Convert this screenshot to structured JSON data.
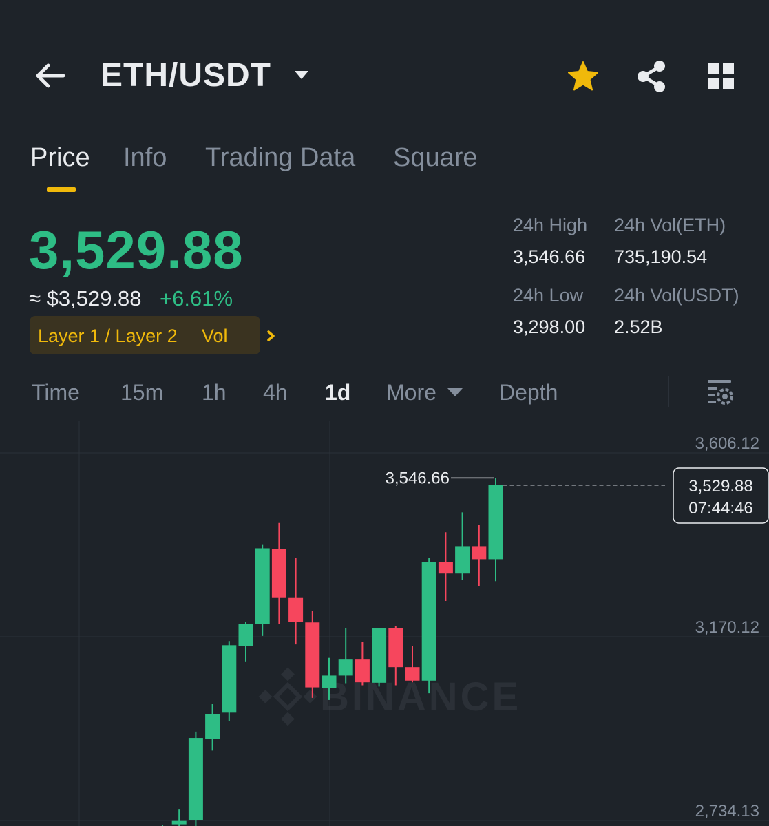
{
  "header": {
    "pair": "ETH/USDT",
    "icons": [
      "arrow-left-icon",
      "caret-down-icon",
      "star-icon",
      "share-icon",
      "grid-icon"
    ],
    "star_color": "#f0b90b"
  },
  "tabs": [
    {
      "label": "Price",
      "active": true
    },
    {
      "label": "Info",
      "active": false
    },
    {
      "label": "Trading Data",
      "active": false
    },
    {
      "label": "Square",
      "active": false
    }
  ],
  "price": {
    "last": "3,529.88",
    "approx_usd": "≈ $3,529.88",
    "change_pct": "+6.61%",
    "tag_category": "Layer 1 / Layer 2",
    "tag_vol": "Vol",
    "up_color": "#2ebd85",
    "down_color": "#f6465d",
    "accent_color": "#f0b90b"
  },
  "stats": {
    "high_label": "24h High",
    "high_value": "3,546.66",
    "vol_eth_label": "24h Vol(ETH)",
    "vol_eth_value": "735,190.54",
    "low_label": "24h Low",
    "low_value": "3,298.00",
    "vol_usdt_label": "24h Vol(USDT)",
    "vol_usdt_value": "2.52B"
  },
  "intervals": [
    {
      "label": "Time",
      "active": false
    },
    {
      "label": "15m",
      "active": false
    },
    {
      "label": "1h",
      "active": false
    },
    {
      "label": "4h",
      "active": false
    },
    {
      "label": "1d",
      "active": true
    },
    {
      "label": "More",
      "active": false
    },
    {
      "label": "Depth",
      "active": false
    }
  ],
  "chart_data": {
    "type": "candlestick",
    "interval": "1d",
    "watermark": "BINANCE",
    "y_ticks": [
      "3,606.12",
      "3,170.12",
      "2,734.13"
    ],
    "y_tick_values": [
      3606.12,
      3170.12,
      2734.13
    ],
    "grid": true,
    "high_marker": "3,546.66",
    "last_price": "3,529.88",
    "countdown": "07:44:46",
    "candles": [
      {
        "o": 2705,
        "h": 2724,
        "l": 2690,
        "c": 2718
      },
      {
        "o": 2725,
        "h": 2760,
        "l": 2715,
        "c": 2733
      },
      {
        "o": 2735,
        "h": 2945,
        "l": 2720,
        "c": 2930
      },
      {
        "o": 2928,
        "h": 3010,
        "l": 2900,
        "c": 2986
      },
      {
        "o": 2990,
        "h": 3160,
        "l": 2970,
        "c": 3150
      },
      {
        "o": 3148,
        "h": 3205,
        "l": 3110,
        "c": 3200
      },
      {
        "o": 3200,
        "h": 3388,
        "l": 3172,
        "c": 3380
      },
      {
        "o": 3378,
        "h": 3440,
        "l": 3200,
        "c": 3262
      },
      {
        "o": 3262,
        "h": 3357,
        "l": 3152,
        "c": 3205
      },
      {
        "o": 3204,
        "h": 3232,
        "l": 3025,
        "c": 3050
      },
      {
        "o": 3048,
        "h": 3120,
        "l": 3020,
        "c": 3078
      },
      {
        "o": 3078,
        "h": 3190,
        "l": 3060,
        "c": 3116
      },
      {
        "o": 3116,
        "h": 3158,
        "l": 3055,
        "c": 3062
      },
      {
        "o": 3061,
        "h": 3185,
        "l": 3052,
        "c": 3190
      },
      {
        "o": 3190,
        "h": 3196,
        "l": 3055,
        "c": 3098
      },
      {
        "o": 3098,
        "h": 3148,
        "l": 3062,
        "c": 3066
      },
      {
        "o": 3066,
        "h": 3358,
        "l": 3036,
        "c": 3348
      },
      {
        "o": 3348,
        "h": 3418,
        "l": 3255,
        "c": 3320
      },
      {
        "o": 3320,
        "h": 3465,
        "l": 3305,
        "c": 3385
      },
      {
        "o": 3385,
        "h": 3435,
        "l": 3290,
        "c": 3354
      },
      {
        "o": 3354,
        "h": 3546.66,
        "l": 3302,
        "c": 3529.88
      }
    ]
  }
}
